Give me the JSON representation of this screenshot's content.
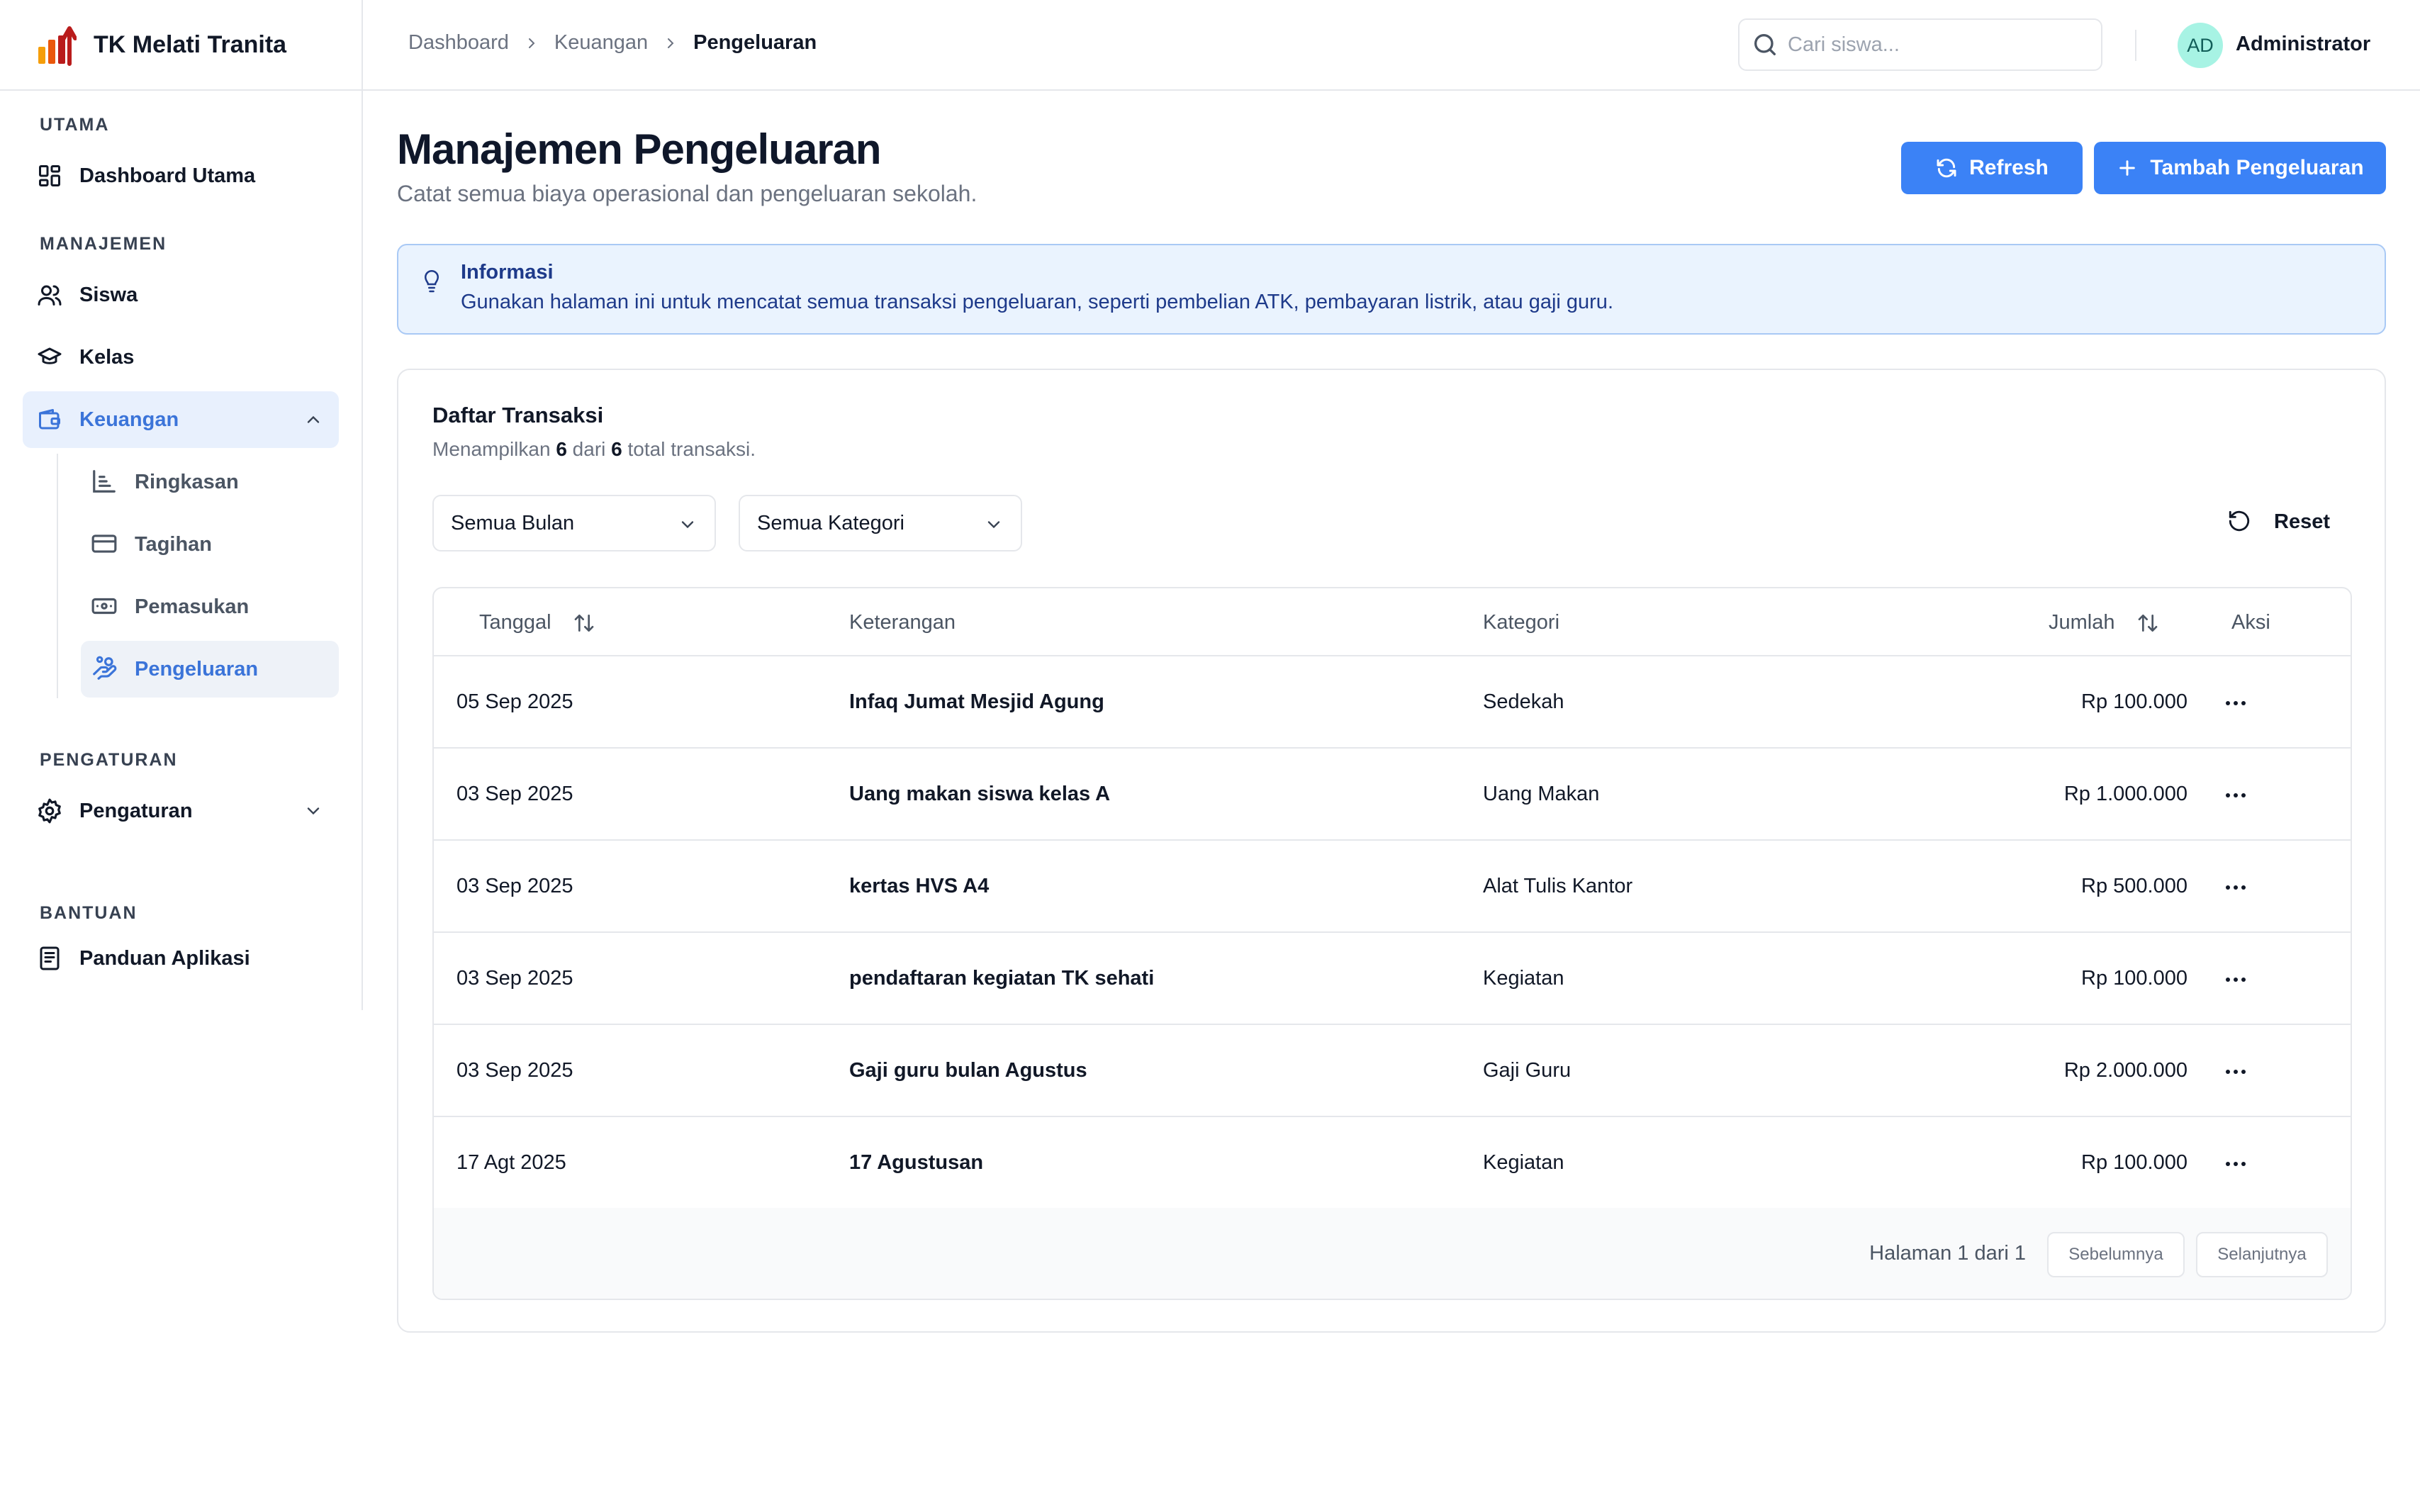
{
  "app": {
    "name": "TK Melati Tranita"
  },
  "sidebar": {
    "groups": {
      "utama": "UTAMA",
      "manajemen": "MANAJEMEN",
      "pengaturan": "PENGATURAN",
      "bantuan": "BANTUAN"
    },
    "items": {
      "dashboard": "Dashboard Utama",
      "siswa": "Siswa",
      "kelas": "Kelas",
      "keuangan": "Keuangan",
      "pengaturan": "Pengaturan",
      "panduan": "Panduan Aplikasi"
    },
    "sub_items": {
      "ringkasan": "Ringkasan",
      "tagihan": "Tagihan",
      "pemasukan": "Pemasukan",
      "pengeluaran": "Pengeluaran"
    }
  },
  "header": {
    "breadcrumb": [
      "Dashboard",
      "Keuangan",
      "Pengeluaran"
    ],
    "search_placeholder": "Cari siswa...",
    "user_initials": "AD",
    "user_name": "Administrator"
  },
  "page": {
    "title": "Manajemen Pengeluaran",
    "subtitle": "Catat semua biaya operasional dan pengeluaran sekolah.",
    "refresh_label": "Refresh",
    "add_label": "Tambah Pengeluaran"
  },
  "info": {
    "title": "Informasi",
    "text": "Gunakan halaman ini untuk mencatat semua transaksi pengeluaran, seperti pembelian ATK, pembayaran listrik, atau gaji guru."
  },
  "list": {
    "title": "Daftar Transaksi",
    "summary_prefix": "Menampilkan",
    "shown": "6",
    "summary_mid": "dari",
    "total": "6",
    "summary_suffix": "total transaksi.",
    "filter_month": "Semua Bulan",
    "filter_category": "Semua Kategori",
    "reset_label": "Reset"
  },
  "table": {
    "columns": {
      "date": "Tanggal",
      "desc": "Keterangan",
      "category": "Kategori",
      "amount": "Jumlah",
      "action": "Aksi"
    },
    "rows": [
      {
        "date": "05 Sep 2025",
        "desc": "Infaq Jumat Mesjid Agung",
        "category": "Sedekah",
        "amount": "Rp 100.000"
      },
      {
        "date": "03 Sep 2025",
        "desc": "Uang makan siswa kelas A",
        "category": "Uang Makan",
        "amount": "Rp 1.000.000"
      },
      {
        "date": "03 Sep 2025",
        "desc": "kertas HVS A4",
        "category": "Alat Tulis Kantor",
        "amount": "Rp 500.000"
      },
      {
        "date": "03 Sep 2025",
        "desc": "pendaftaran kegiatan TK sehati",
        "category": "Kegiatan",
        "amount": "Rp 100.000"
      },
      {
        "date": "03 Sep 2025",
        "desc": "Gaji guru bulan Agustus",
        "category": "Gaji Guru",
        "amount": "Rp 2.000.000"
      },
      {
        "date": "17 Agt 2025",
        "desc": "17 Agustusan",
        "category": "Kegiatan",
        "amount": "Rp 100.000"
      }
    ],
    "pagination": {
      "page_info": "Halaman 1 dari 1",
      "prev_label": "Sebelumnya",
      "next_label": "Selanjutnya"
    }
  },
  "colors": {
    "accent": "#3b82f6",
    "active_nav_bg": "#e8f0fd",
    "active_nav_text": "#3b74d9",
    "info_bg": "#eaf3fe",
    "info_text": "#1e3a8a",
    "avatar_bg": "#a7f3e4"
  }
}
